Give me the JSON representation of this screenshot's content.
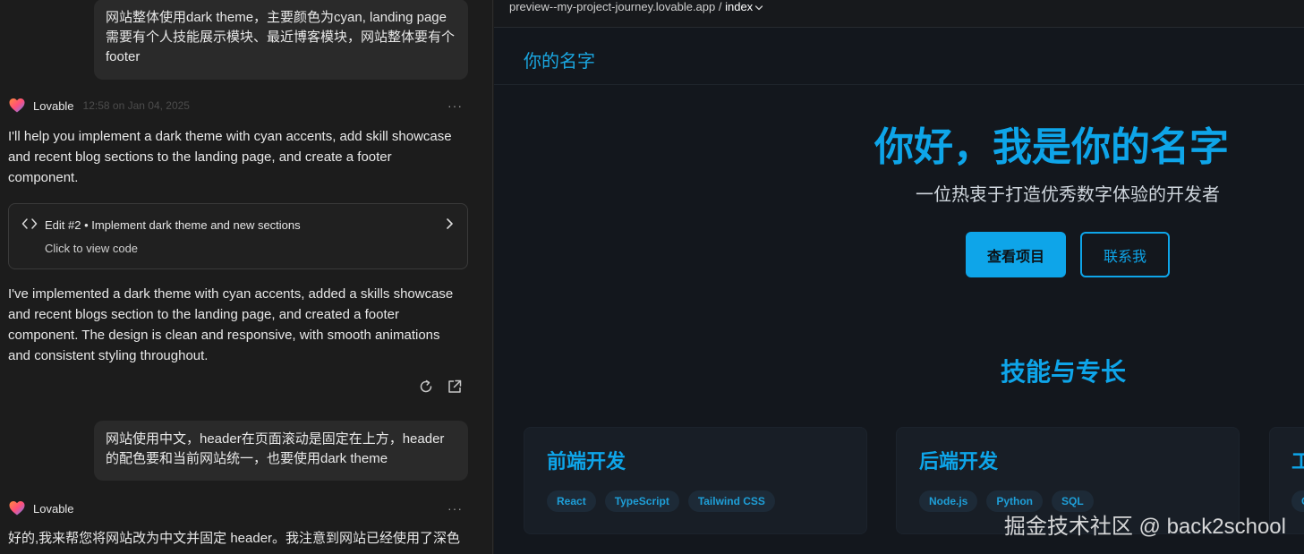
{
  "chat": {
    "messages": [
      {
        "role": "user",
        "text": "网站整体使用dark theme，主要颜色为cyan, landing page 需要有个人技能展示模块、最近博客模块，网站整体要有个footer"
      },
      {
        "role": "assistant",
        "name": "Lovable",
        "time": "12:58 on Jan 04, 2025",
        "text": "I'll help you implement a dark theme with cyan accents, add skill showcase and recent blog sections to the landing page, and create a footer component.",
        "edit": {
          "title": "Edit #2 • Implement dark theme and new sections",
          "subtitle": "Click to view code"
        },
        "text2": "I've implemented a dark theme with cyan accents, added a skills showcase and recent blogs section to the landing page, and created a footer component. The design is clean and responsive, with smooth animations and consistent styling throughout."
      },
      {
        "role": "user",
        "text": "网站使用中文，header在页面滚动是固定在上方，header 的配色要和当前网站统一，也要使用dark theme"
      },
      {
        "role": "assistant",
        "name": "Lovable",
        "text": "好的,我来帮您将网站改为中文并固定 header。我注意到网站已经使用了深色"
      }
    ],
    "more_label": "···"
  },
  "preview": {
    "url_host": "preview--my-project-journey.lovable.app",
    "url_sep": " / ",
    "url_page": "index",
    "site": {
      "brand": "你的名字",
      "hero_title": "你好，我是你的名字",
      "hero_subtitle": "一位热衷于打造优秀数字体验的开发者",
      "primary_button": "查看项目",
      "secondary_button": "联系我",
      "skills_title": "技能与专长",
      "skills": [
        {
          "title": "前端开发",
          "tags": [
            "React",
            "TypeScript",
            "Tailwind CSS"
          ]
        },
        {
          "title": "后端开发",
          "tags": [
            "Node.js",
            "Python",
            "SQL"
          ]
        },
        {
          "title": "工",
          "tags": [
            "C"
          ]
        }
      ]
    },
    "watermark": "掘金技术社区 @ back2school"
  },
  "colors": {
    "accent": "#0ea5e9",
    "chat_bg": "#1c1c1c",
    "site_bg": "#13171d"
  }
}
